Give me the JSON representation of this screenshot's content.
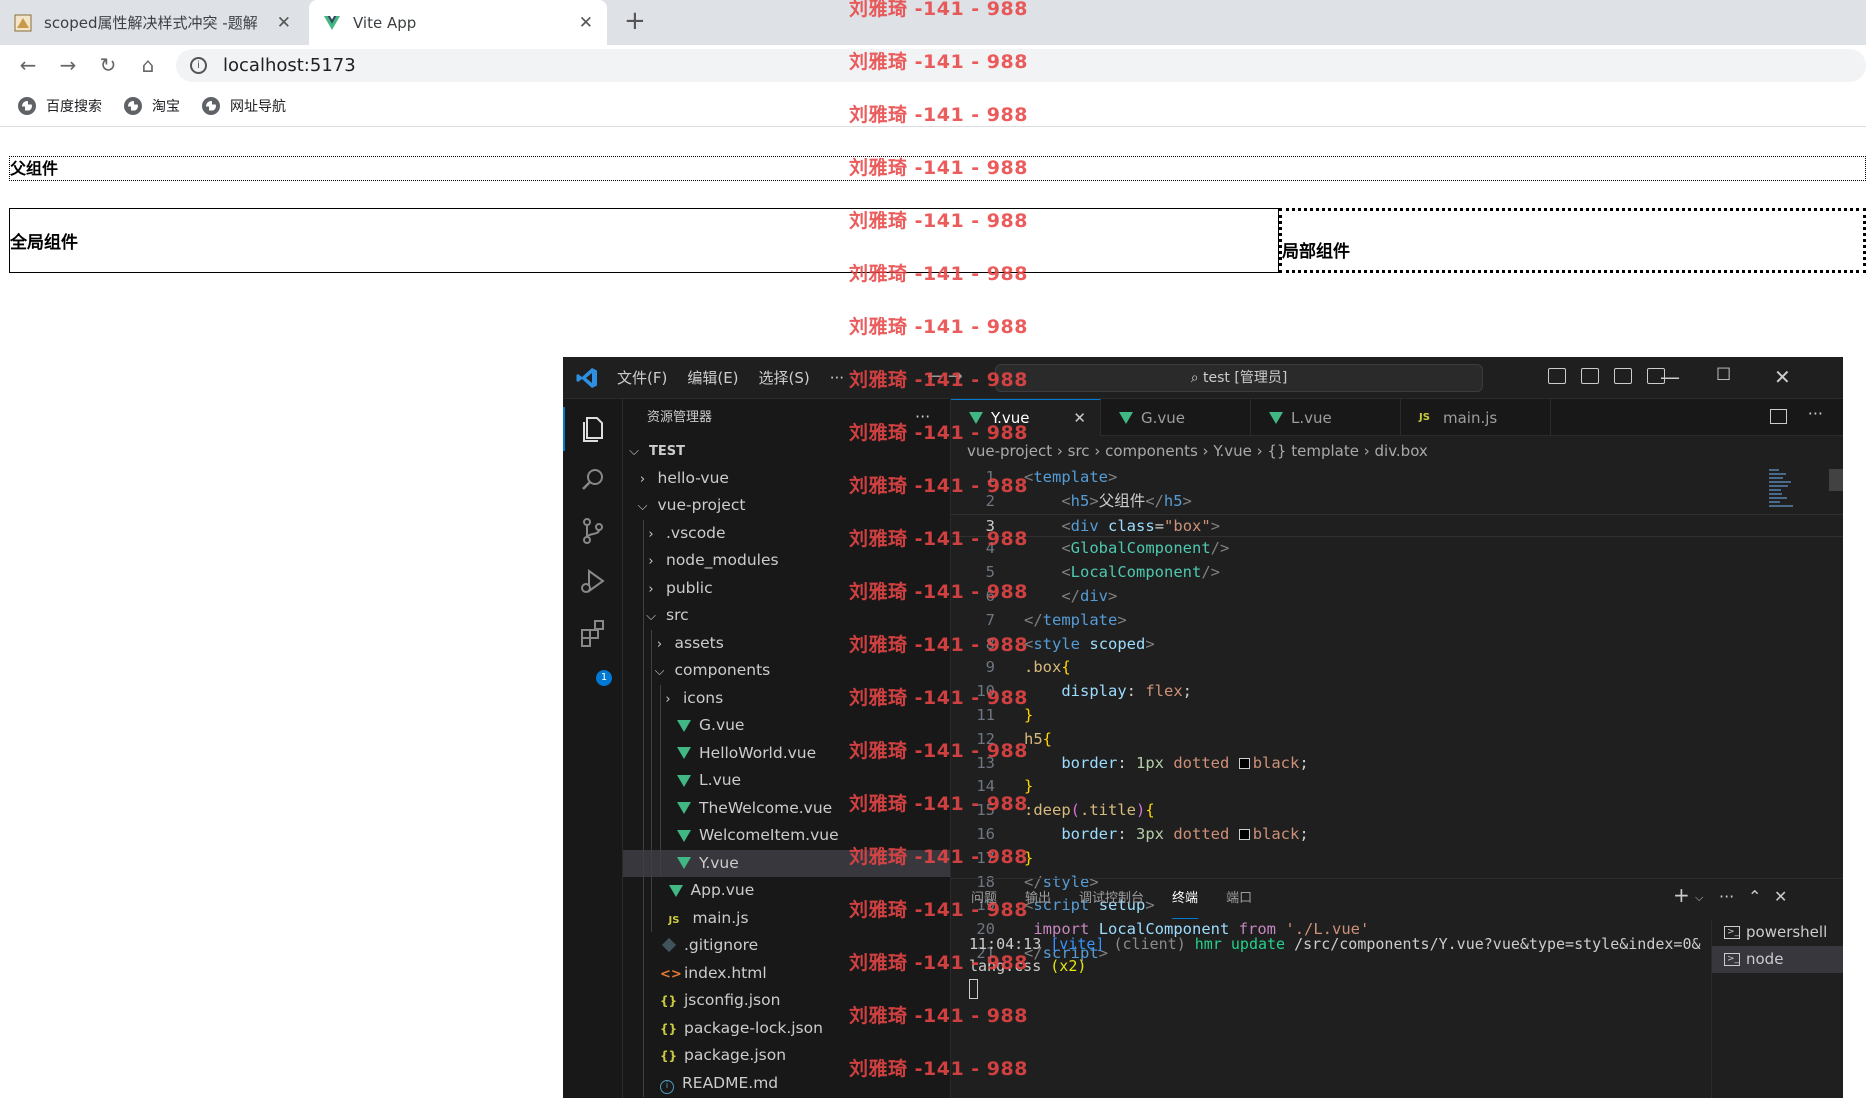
{
  "browser": {
    "tabs": [
      {
        "title": "scoped属性解决样式冲突 -题解",
        "active": false
      },
      {
        "title": "Vite App",
        "active": true
      }
    ],
    "url": "localhost:5173",
    "bookmarks": [
      "百度搜索",
      "淘宝",
      "网址导航"
    ]
  },
  "page": {
    "h5": "父组件",
    "global": "全局组件",
    "local": "局部组件"
  },
  "vscode": {
    "menus": [
      "文件(F)",
      "编辑(E)",
      "选择(S)",
      "···"
    ],
    "search": "test [管理员]",
    "explorer_title": "资源管理器",
    "tree": [
      {
        "label": "TEST",
        "indent": 0,
        "arrow": "v",
        "icon": "",
        "bold": true
      },
      {
        "label": "hello-vue",
        "indent": 1,
        "arrow": ">",
        "icon": ""
      },
      {
        "label": "vue-project",
        "indent": 1,
        "arrow": "v",
        "icon": ""
      },
      {
        "label": ".vscode",
        "indent": 2,
        "arrow": ">",
        "icon": ""
      },
      {
        "label": "node_modules",
        "indent": 2,
        "arrow": ">",
        "icon": ""
      },
      {
        "label": "public",
        "indent": 2,
        "arrow": ">",
        "icon": ""
      },
      {
        "label": "src",
        "indent": 2,
        "arrow": "v",
        "icon": ""
      },
      {
        "label": "assets",
        "indent": 3,
        "arrow": ">",
        "icon": ""
      },
      {
        "label": "components",
        "indent": 3,
        "arrow": "v",
        "icon": ""
      },
      {
        "label": "icons",
        "indent": 4,
        "arrow": ">",
        "icon": ""
      },
      {
        "label": "G.vue",
        "indent": 4,
        "arrow": "",
        "icon": "vue"
      },
      {
        "label": "HelloWorld.vue",
        "indent": 4,
        "arrow": "",
        "icon": "vue"
      },
      {
        "label": "L.vue",
        "indent": 4,
        "arrow": "",
        "icon": "vue"
      },
      {
        "label": "TheWelcome.vue",
        "indent": 4,
        "arrow": "",
        "icon": "vue"
      },
      {
        "label": "WelcomeItem.vue",
        "indent": 4,
        "arrow": "",
        "icon": "vue"
      },
      {
        "label": "Y.vue",
        "indent": 4,
        "arrow": "",
        "icon": "vue",
        "selected": true
      },
      {
        "label": "App.vue",
        "indent": 3,
        "arrow": "",
        "icon": "vue"
      },
      {
        "label": "main.js",
        "indent": 3,
        "arrow": "",
        "icon": "js"
      },
      {
        "label": ".gitignore",
        "indent": 2,
        "arrow": "",
        "icon": "git"
      },
      {
        "label": "index.html",
        "indent": 2,
        "arrow": "",
        "icon": "html"
      },
      {
        "label": "jsconfig.json",
        "indent": 2,
        "arrow": "",
        "icon": "json"
      },
      {
        "label": "package-lock.json",
        "indent": 2,
        "arrow": "",
        "icon": "json"
      },
      {
        "label": "package.json",
        "indent": 2,
        "arrow": "",
        "icon": "json"
      },
      {
        "label": "README.md",
        "indent": 2,
        "arrow": "",
        "icon": "info"
      }
    ],
    "tabs": [
      {
        "label": "Y.vue",
        "icon": "vue",
        "active": true
      },
      {
        "label": "G.vue",
        "icon": "vue",
        "active": false
      },
      {
        "label": "L.vue",
        "icon": "vue",
        "active": false
      },
      {
        "label": "main.js",
        "icon": "js",
        "active": false
      }
    ],
    "breadcrumb": [
      "vue-project",
      "src",
      "components",
      "Y.vue",
      "{} template",
      "div.box"
    ],
    "code": [
      [
        [
          "c-tag",
          "<"
        ],
        [
          "c-el",
          "template"
        ],
        [
          "c-tag",
          ">"
        ]
      ],
      [
        [
          "c-txt",
          "    "
        ],
        [
          "c-tag",
          "<"
        ],
        [
          "c-el",
          "h5"
        ],
        [
          "c-tag",
          ">"
        ],
        [
          "c-txt",
          "父组件"
        ],
        [
          "c-tag",
          "</"
        ],
        [
          "c-el",
          "h5"
        ],
        [
          "c-tag",
          ">"
        ]
      ],
      [
        [
          "c-txt",
          "    "
        ],
        [
          "c-tag",
          "<"
        ],
        [
          "c-el",
          "div"
        ],
        [
          "c-txt",
          " "
        ],
        [
          "c-attr",
          "class"
        ],
        [
          "c-txt",
          "="
        ],
        [
          "c-str",
          "\"box\""
        ],
        [
          "c-tag",
          ">"
        ]
      ],
      [
        [
          "c-txt",
          "    "
        ],
        [
          "c-tag",
          "<"
        ],
        [
          "c-comp",
          "GlobalComponent"
        ],
        [
          "c-tag",
          "/>"
        ]
      ],
      [
        [
          "c-txt",
          "    "
        ],
        [
          "c-tag",
          "<"
        ],
        [
          "c-comp",
          "LocalComponent"
        ],
        [
          "c-tag",
          "/>"
        ]
      ],
      [
        [
          "c-txt",
          "    "
        ],
        [
          "c-tag",
          "</"
        ],
        [
          "c-el",
          "div"
        ],
        [
          "c-tag",
          ">"
        ]
      ],
      [
        [
          "c-tag",
          "</"
        ],
        [
          "c-el",
          "template"
        ],
        [
          "c-tag",
          ">"
        ]
      ],
      [
        [
          "c-tag",
          "<"
        ],
        [
          "c-el",
          "style"
        ],
        [
          "c-txt",
          " "
        ],
        [
          "c-attr",
          "scoped"
        ],
        [
          "c-tag",
          ">"
        ]
      ],
      [
        [
          "c-sel",
          ".box"
        ],
        [
          "c-br",
          "{"
        ]
      ],
      [
        [
          "c-txt",
          "    "
        ],
        [
          "c-prop",
          "display"
        ],
        [
          "c-txt",
          ": "
        ],
        [
          "c-val",
          "flex"
        ],
        [
          "c-txt",
          ";"
        ]
      ],
      [
        [
          "c-br",
          "}"
        ]
      ],
      [
        [
          "c-sel",
          "h5"
        ],
        [
          "c-br",
          "{"
        ]
      ],
      [
        [
          "c-txt",
          "    "
        ],
        [
          "c-prop",
          "border"
        ],
        [
          "c-txt",
          ": "
        ],
        [
          "c-num",
          "1px"
        ],
        [
          "c-txt",
          " "
        ],
        [
          "c-val",
          "dotted"
        ],
        [
          "c-txt",
          " "
        ],
        [
          "swatch",
          ""
        ],
        [
          "c-val",
          "black"
        ],
        [
          "c-txt",
          ";"
        ]
      ],
      [
        [
          "c-br",
          "}"
        ]
      ],
      [
        [
          "c-sel",
          ":deep"
        ],
        [
          "c-br2",
          "("
        ],
        [
          "c-sel",
          ".title"
        ],
        [
          "c-br2",
          ")"
        ],
        [
          "c-br",
          "{"
        ]
      ],
      [
        [
          "c-txt",
          "    "
        ],
        [
          "c-prop",
          "border"
        ],
        [
          "c-txt",
          ": "
        ],
        [
          "c-num",
          "3px"
        ],
        [
          "c-txt",
          " "
        ],
        [
          "c-val",
          "dotted"
        ],
        [
          "c-txt",
          " "
        ],
        [
          "swatch",
          ""
        ],
        [
          "c-val",
          "black"
        ],
        [
          "c-txt",
          ";"
        ]
      ],
      [
        [
          "c-br",
          "}"
        ]
      ],
      [
        [
          "c-tag",
          "</"
        ],
        [
          "c-el",
          "style"
        ],
        [
          "c-tag",
          ">"
        ]
      ],
      [
        [
          "c-tag",
          "<"
        ],
        [
          "c-el",
          "script"
        ],
        [
          "c-txt",
          " "
        ],
        [
          "c-attr",
          "setup"
        ],
        [
          "c-tag",
          ">"
        ]
      ],
      [
        [
          "c-txt",
          " "
        ],
        [
          "c-kw",
          "import"
        ],
        [
          "c-txt",
          " "
        ],
        [
          "c-attr",
          "LocalComponent"
        ],
        [
          "c-txt",
          " "
        ],
        [
          "c-kw",
          "from"
        ],
        [
          "c-txt",
          " "
        ],
        [
          "c-str",
          "'./L.vue'"
        ]
      ],
      [
        [
          "c-tag",
          "</"
        ],
        [
          "c-el",
          "script"
        ],
        [
          "c-tag",
          ">"
        ]
      ]
    ],
    "current_line": 3,
    "panel_tabs": [
      "问题",
      "输出",
      "调试控制台",
      "终端",
      "端口"
    ],
    "panel_active": "终端",
    "terminal": {
      "time": "11:04:13",
      "tag": "[vite]",
      "client": "(client)",
      "msg": "hmr update",
      "path": "/src/components/Y.vue?vue&type=style&index=0&lang.css",
      "count": "(x2)"
    },
    "terminal_list": [
      {
        "label": "powershell",
        "selected": false
      },
      {
        "label": "node",
        "selected": true
      }
    ]
  },
  "watermark": {
    "text": "刘雅琦 -141 - 988",
    "count": 21
  },
  "colors": {
    "accent": "#0078d4",
    "vue_green": "#41b883",
    "watermark_red": "#e84646"
  }
}
